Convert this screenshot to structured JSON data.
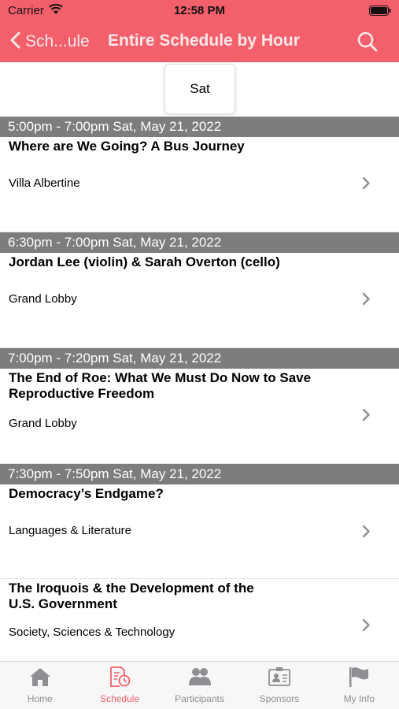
{
  "status": {
    "carrier": "Carrier",
    "time": "12:58 PM"
  },
  "nav": {
    "back_label": "Sch...ule",
    "title": "Entire Schedule by Hour"
  },
  "day_tab": "Sat",
  "sections": [
    {
      "header": "5:00pm - 7:00pm Sat, May 21, 2022",
      "items": [
        {
          "title": "Where are We Going? A Bus Journey",
          "location": "Villa Albertine"
        }
      ]
    },
    {
      "header": "6:30pm - 7:00pm Sat, May 21, 2022",
      "items": [
        {
          "title": "Jordan Lee (violin) & Sarah Overton (cello)",
          "location": "Grand Lobby"
        }
      ]
    },
    {
      "header": "7:00pm - 7:20pm Sat, May 21, 2022",
      "items": [
        {
          "title": "The End of Roe: What We Must Do Now to Save Reproductive Freedom",
          "location": "Grand Lobby"
        }
      ]
    },
    {
      "header": "7:30pm - 7:50pm Sat, May 21, 2022",
      "items": [
        {
          "title": "Democracy’s Endgame?",
          "location": "Languages & Literature"
        },
        {
          "title": "The Iroquois & the Development of the U.S. Government",
          "location": "Society, Sciences & Technology"
        }
      ]
    }
  ],
  "tabs": [
    {
      "label": "Home",
      "icon": "home-icon"
    },
    {
      "label": "Schedule",
      "icon": "schedule-icon"
    },
    {
      "label": "Participants",
      "icon": "participants-icon"
    },
    {
      "label": "Sponsors",
      "icon": "sponsors-icon"
    },
    {
      "label": "My Info",
      "icon": "flag-icon"
    }
  ],
  "colors": {
    "accent": "#f3606b",
    "section_header": "#7d7d7d",
    "tab_inactive": "#8e8e93"
  }
}
